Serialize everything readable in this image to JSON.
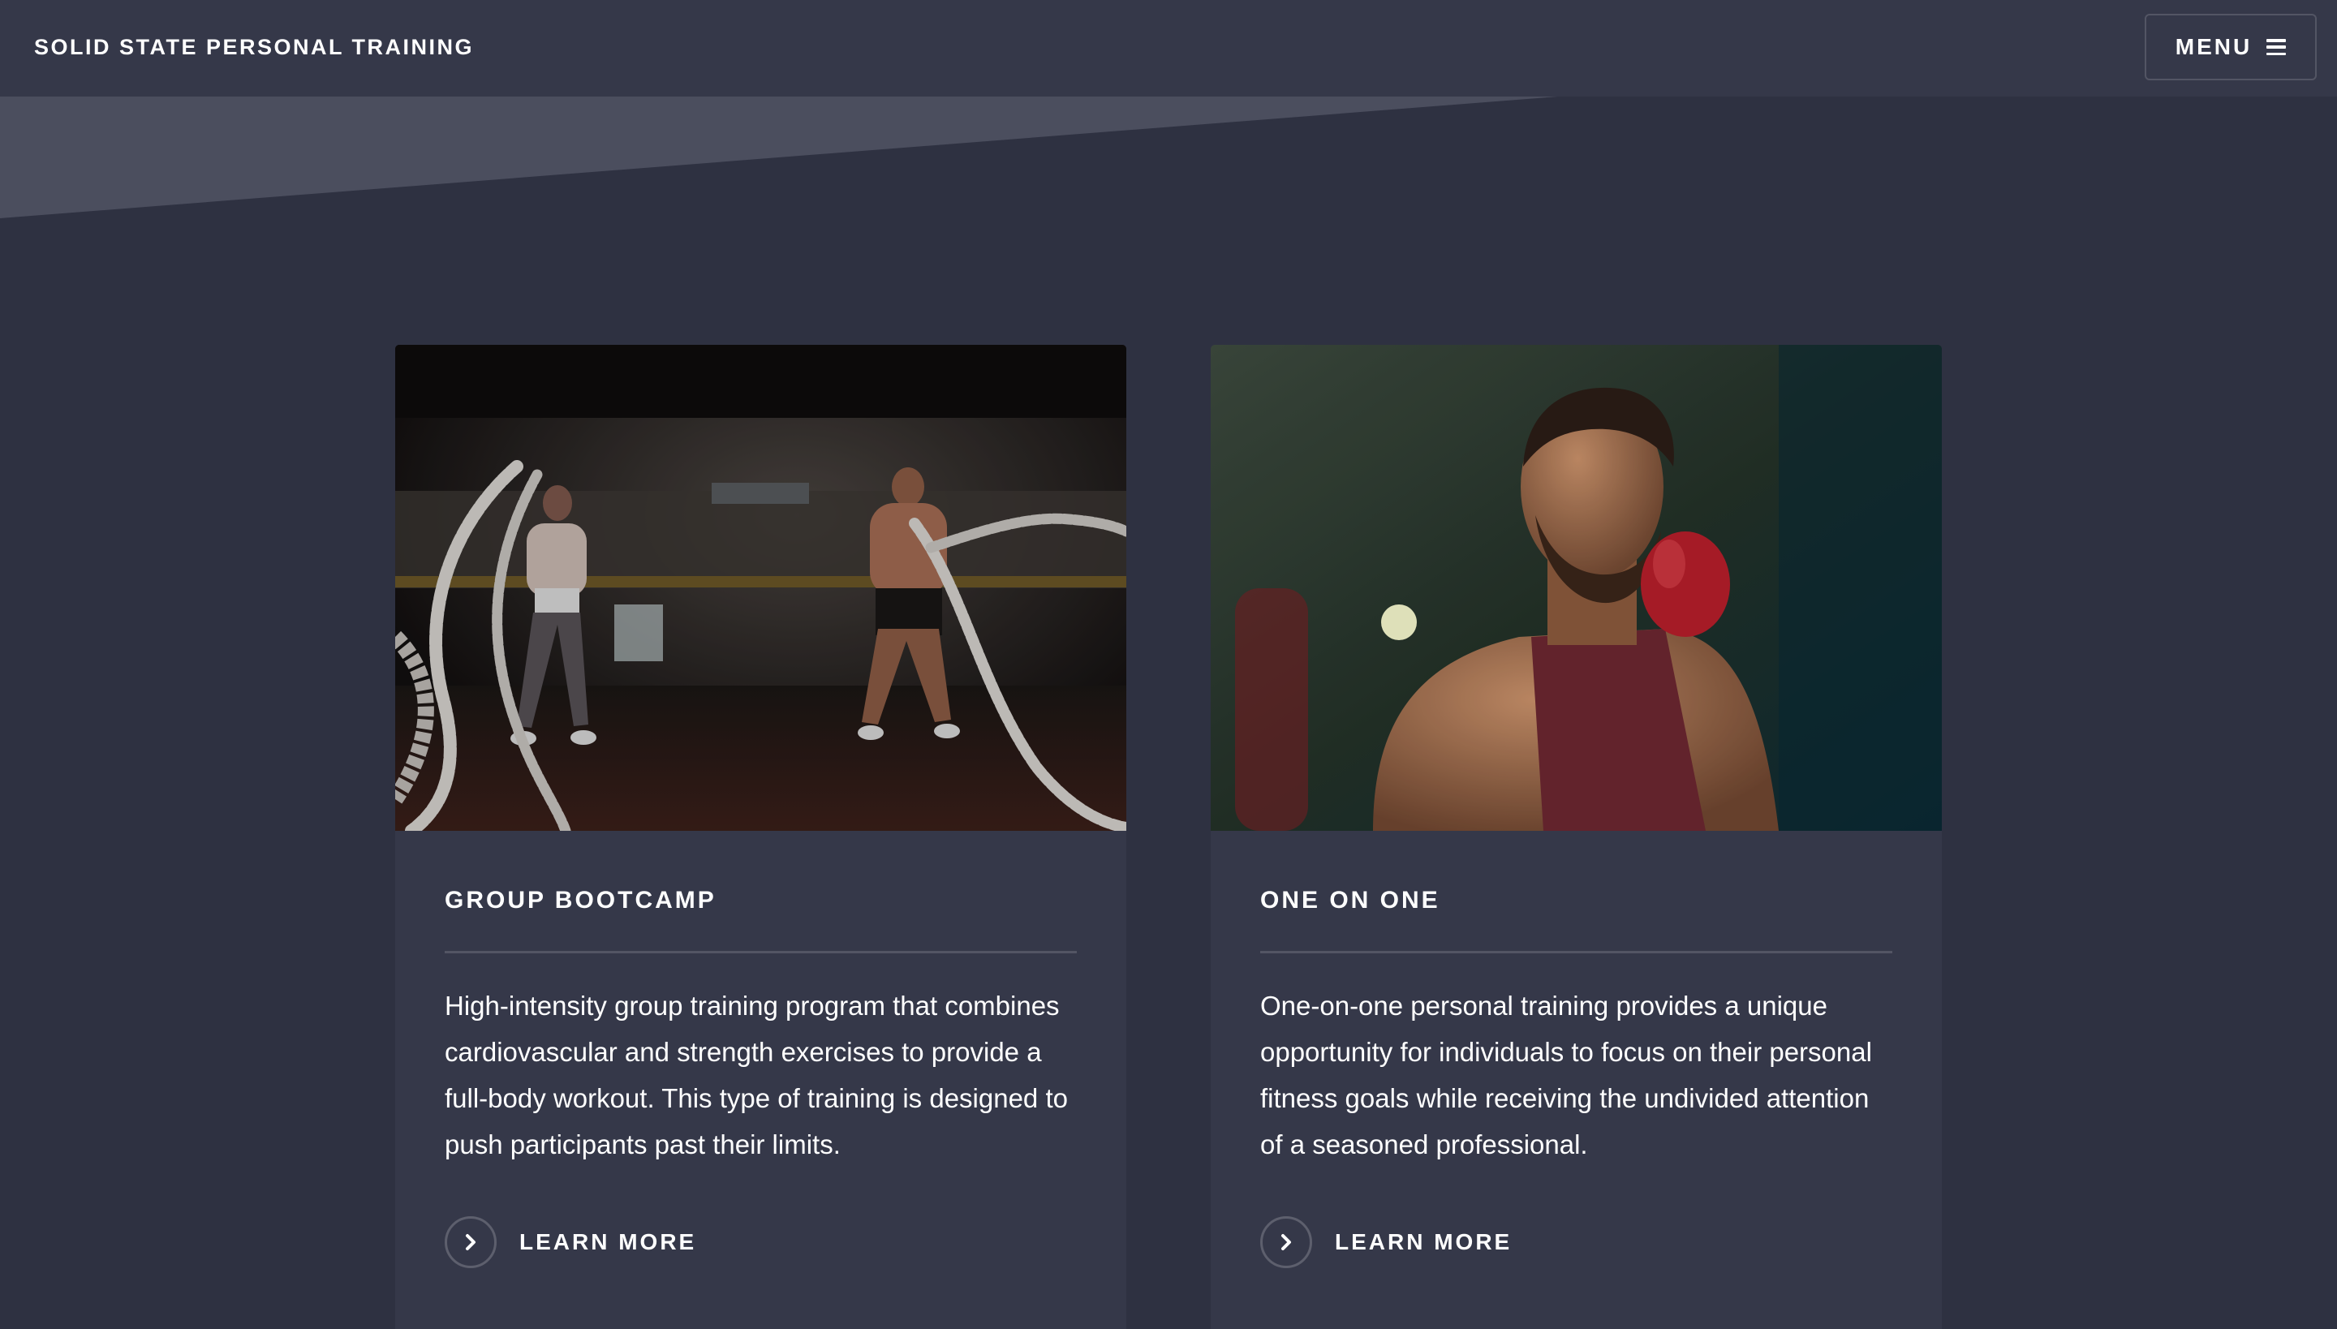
{
  "header": {
    "site_title": "SOLID STATE PERSONAL TRAINING",
    "menu_label": "MENU",
    "menu_icon": "hamburger-icon"
  },
  "colors": {
    "background": "#2e3141",
    "header_background": "#353849",
    "card_background": "#353849",
    "banner_wedge": "#4b4e5e",
    "text": "#ffffff"
  },
  "cards": [
    {
      "image_description_icon": "photo-battle-ropes",
      "title": "GROUP BOOTCAMP",
      "description": "High-intensity group training program that combines cardiovascular and strength exercises to provide a full-body workout. This type of training is designed to push participants past their limits.",
      "link_label": "LEARN MORE",
      "link_icon": "chevron-right-icon"
    },
    {
      "image_description_icon": "photo-boxer",
      "title": "ONE ON ONE",
      "description": "One-on-one personal training provides a unique opportunity for individuals to focus on their personal fitness goals while receiving the undivided attention of a seasoned professional.",
      "link_label": "LEARN MORE",
      "link_icon": "chevron-right-icon"
    }
  ]
}
